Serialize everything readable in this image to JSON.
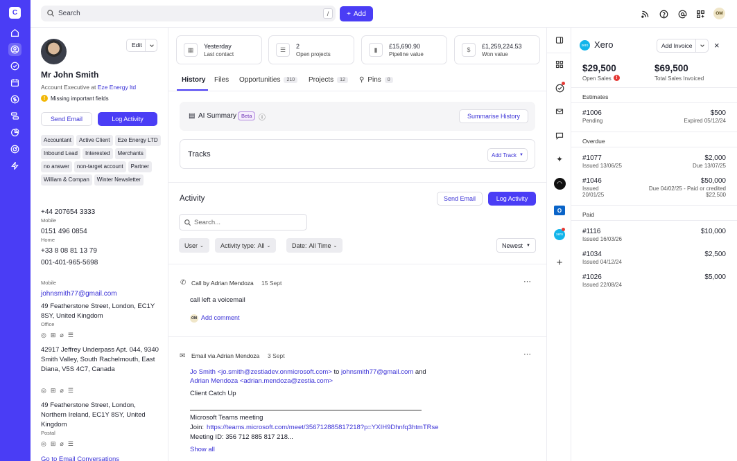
{
  "app": {
    "logo_letter": "C",
    "accent": "#4a3df5"
  },
  "rail": [
    "home-icon",
    "contacts-icon",
    "tasks-icon",
    "calendar-icon",
    "deals-icon",
    "pipeline-icon",
    "reports-icon",
    "goals-icon",
    "automation-icon"
  ],
  "topbar": {
    "search_label": "Search",
    "search_key": "/",
    "add_label": "Add",
    "avatar": "OM"
  },
  "contact": {
    "edit": "Edit",
    "name": "Mr John Smith",
    "role_prefix": "Account Executive at",
    "company": "Eze Energy ltd",
    "warning": "Missing important fields",
    "send_email": "Send Email",
    "log_activity": "Log Activity",
    "tags": [
      "Accountant",
      "Active Client",
      "Eze Energy LTD",
      "Inbound Lead",
      "Interested",
      "Merchants",
      "no answer",
      "non-target account",
      "Partner",
      "William & Compan",
      "Winter Newsletter"
    ],
    "phones": [
      {
        "number": "+44 207654 3333",
        "label": "Mobile"
      },
      {
        "number": "0151 496 0854",
        "label": "Home"
      },
      {
        "number": "+33 8 08 81 13 79",
        "label": ""
      },
      {
        "number": "001-401-965-5698",
        "label": ""
      }
    ],
    "email_label": "Mobile",
    "email": "johnsmith77@gmail.com",
    "addresses": [
      {
        "text": "49 Featherstone Street, London, EC1Y 8SY, United Kingdom",
        "label": "Office"
      },
      {
        "text": "42917 Jeffrey Underpass Apt. 044, 9340 Smith Valley, South Rachelmouth, East Diana, V5S 4C7, Canada",
        "label": ""
      },
      {
        "text": "49 Featherstone Street, London, Northern Ireland, EC1Y 8SY, United Kingdom",
        "label": "Postal"
      }
    ],
    "go_email": "Go to Email Conversations"
  },
  "stats": [
    {
      "value": "Yesterday",
      "label": "Last contact",
      "icon": "calendar-icon"
    },
    {
      "value": "2",
      "label": "Open projects",
      "icon": "list-icon"
    },
    {
      "value": "£15,690.90",
      "label": "Pipeline value",
      "icon": "bar-chart-icon"
    },
    {
      "value": "£1,259,224.53",
      "label": "Won value",
      "icon": "dollar-icon"
    }
  ],
  "tabs": [
    {
      "label": "History",
      "count": ""
    },
    {
      "label": "Files",
      "count": ""
    },
    {
      "label": "Opportunities",
      "count": "210"
    },
    {
      "label": "Projects",
      "count": "12"
    },
    {
      "label": "Pins",
      "count": "0"
    }
  ],
  "ai": {
    "label": "AI Summary",
    "beta": "Beta",
    "button": "Summarise History"
  },
  "tracks": {
    "label": "Tracks",
    "button": "Add Track"
  },
  "activity": {
    "title": "Activity",
    "send_email": "Send Email",
    "log_activity": "Log Activity",
    "search_placeholder": "Search...",
    "filters": {
      "user": "User",
      "type_label": "Activity type:",
      "type_value": "All",
      "date_label": "Date:",
      "date_value": "All Time"
    },
    "sort": "Newest",
    "items": [
      {
        "header": "Call by Adrian Mendoza",
        "date": "15 Sept",
        "body": "call left a voicemail",
        "add_comment": "Add comment",
        "avatar": "OM"
      },
      {
        "header": "Email via Adrian Mendoza",
        "date": "3 Sept",
        "from": "Jo Smith <jo.smith@zestiadev.onmicrosoft.com>",
        "to_word": "to",
        "to": "johnsmith77@gmail.com",
        "and_word": "and",
        "cc": "Adrian Mendoza <adrian.mendoza@zestia.com>",
        "subject": "Client Catch Up",
        "teams": "Microsoft Teams meeting",
        "join_label": "Join:",
        "join_link": "https://teams.microsoft.com/meet/356712885817218?p=YXIH9Dhnfq3htmTRse",
        "meeting_id": "Meeting ID: 356 712 885 817 218...",
        "show_all": "Show all"
      }
    ]
  },
  "xero": {
    "title": "Xero",
    "add_invoice": "Add Invoice",
    "open_sales": "$29,500",
    "open_sales_label": "Open Sales",
    "total_sales": "$69,500",
    "total_sales_label": "Total Sales Invoiced",
    "estimates_label": "Estimates",
    "estimates": [
      {
        "id": "#1006",
        "sub": "Pending",
        "amount": "$500",
        "right_sub": "Expired 05/12/24"
      }
    ],
    "overdue_label": "Overdue",
    "overdue": [
      {
        "id": "#1077",
        "sub": "Issued 13/06/25",
        "amount": "$2,000",
        "right_sub": "Due 13/07/25"
      },
      {
        "id": "#1046",
        "sub": "Issued 20/01/25",
        "amount": "$50,000",
        "right_sub": "Due 04/02/25 - Paid or credited $22,500"
      }
    ],
    "paid_label": "Paid",
    "paid": [
      {
        "id": "#1116",
        "sub": "Issued 16/03/26",
        "amount": "$10,000"
      },
      {
        "id": "#1034",
        "sub": "Issued 04/12/24",
        "amount": "$2,500"
      },
      {
        "id": "#1026",
        "sub": "Issued 22/08/24",
        "amount": "$5,000"
      }
    ]
  }
}
